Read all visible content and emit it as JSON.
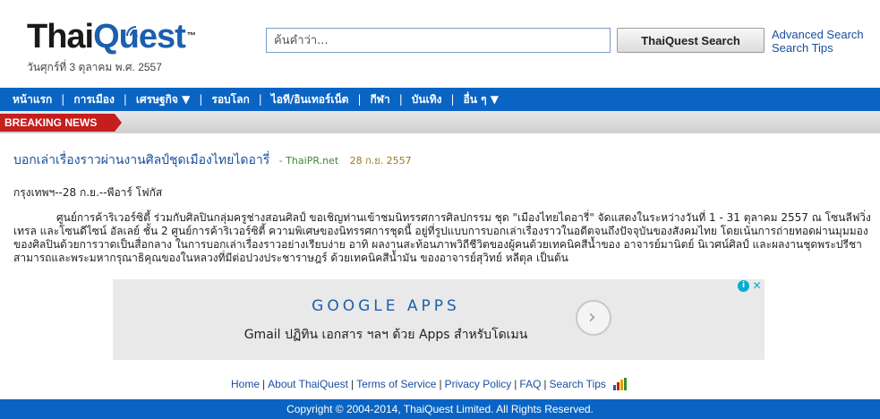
{
  "header": {
    "logo_text_a": "Thai",
    "logo_text_b": "Quest",
    "logo_tm": "™",
    "date": "วันศุกร์ที่ 3 ตุลาคม พ.ศ. 2557",
    "search_placeholder": "ค้นคำว่า...",
    "search_button": "ThaiQuest Search",
    "advanced_search": "Advanced Search",
    "search_tips": "Search Tips"
  },
  "nav": {
    "items": [
      "หน้าแรก",
      "การเมือง",
      "เศรษฐกิจ ▼",
      "รอบโลก",
      "ไอที/อินเทอร์เน็ต",
      "กีฬา",
      "บันเทิง",
      "อื่น ๆ ▼"
    ],
    "separator": "|",
    "color": "#0a64c4"
  },
  "breaking": {
    "label": "BREAKING NEWS",
    "color": "#c61d1d"
  },
  "article": {
    "title": "บอกเล่าเรื่องราวผ่านงานศิลป์ชุดเมืองไทยไดอารี่",
    "source": "- ThaiPR.net",
    "date": "28 ก.ย. 2557",
    "byline": "กรุงเทพฯ--28 ก.ย.--พีอาร์ โฟกัส",
    "body": "ศูนย์การค้าริเวอร์ซิตี้ ร่วมกับศิลปินกลุ่มครูช่างสอนศิลป์ ขอเชิญท่านเข้าชมนิทรรศการศิลปกรรม ชุด \"เมืองไทยไดอารี่\" จัดแสดงในระหว่างวันที่ 1 - 31 ตุลาคม 2557 ณ โซนลีฟวิ่ง เทรล และโซนดีไซน์ อัลเลย์ ชั้น 2 ศูนย์การค้าริเวอร์ซิตี้ ความพิเศษของนิทรรศการชุดนี้ อยู่ที่รูปแบบการบอกเล่าเรื่องราวในอดีตจนถึงปัจจุบันของสังคมไทย โดยเน้นการถ่ายทอดผ่านมุมมองของศิลปินด้วยการวาดเป็นสื่อกลาง ในการบอกเล่าเรื่องราวอย่างเรียบง่าย อาทิ ผลงานสะท้อนภาพวิถีชีวิตของผู้คนด้วยเทคนิคสีน้ำของ อาจารย์มานิตย์ นิเวศน์ศิลป์ และผลงานชุดพระปรีชาสามารถและพระมหากรุณาธิคุณของในหลวงที่มีต่อปวงประชาราษฎร์ ด้วยเทคนิคสีน้ำมัน ของอาจารย์สุวิทย์ หลีตุล เป็นต้น"
  },
  "ad": {
    "title": "GOOGLE APPS",
    "subtitle": "Gmail ปฏิทิน เอกสาร ฯลฯ ด้วย Apps สำหรับโดเมน",
    "arrow": "›",
    "info": "i",
    "close": "✕"
  },
  "footer": {
    "links": [
      "Home",
      "About ThaiQuest",
      "Terms of Service",
      "Privacy Policy",
      "FAQ",
      "Search Tips"
    ],
    "separator": "|",
    "copyright": "Copyright © 2004-2014, ThaiQuest Limited. All Rights Reserved."
  }
}
